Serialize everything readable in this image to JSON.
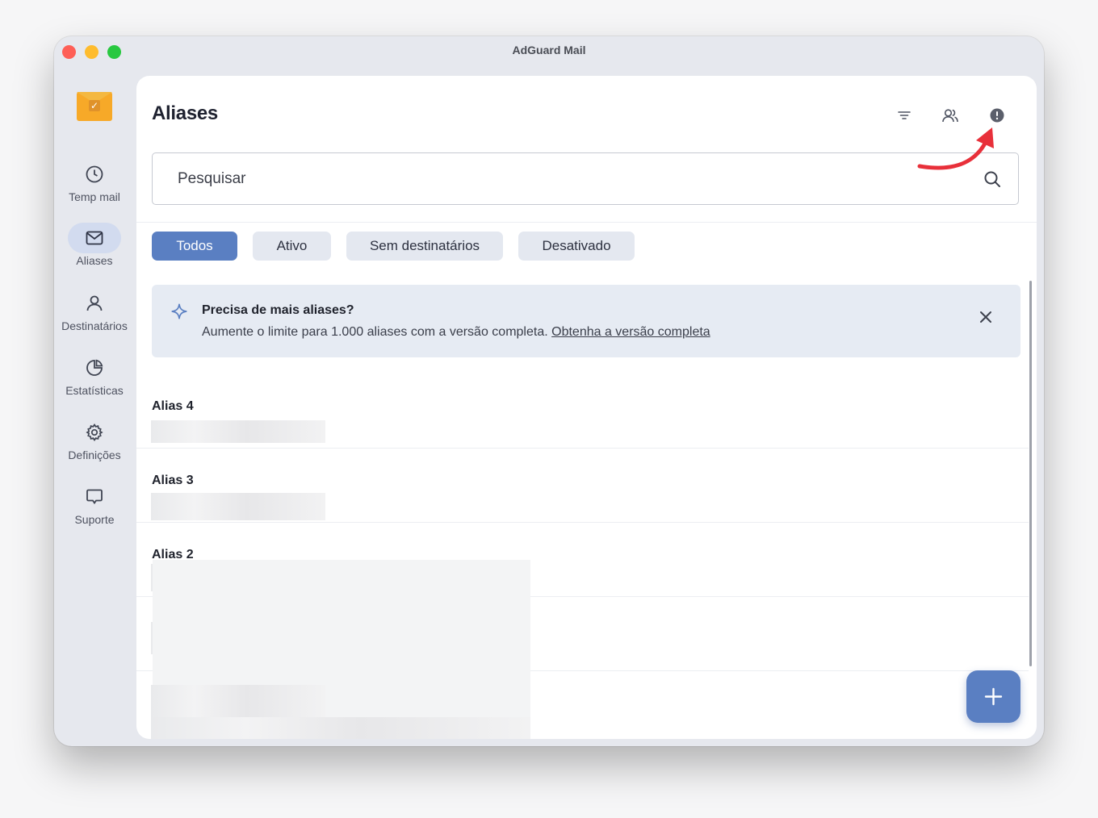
{
  "window": {
    "title": "AdGuard Mail"
  },
  "sidebar": {
    "items": [
      {
        "label": "Temp mail",
        "icon": "clock-icon",
        "active": false
      },
      {
        "label": "Aliases",
        "icon": "mail-icon",
        "active": true
      },
      {
        "label": "Destinatários",
        "icon": "user-icon",
        "active": false
      },
      {
        "label": "Estatísticas",
        "icon": "pie-chart-icon",
        "active": false
      },
      {
        "label": "Definições",
        "icon": "gear-icon",
        "active": false
      },
      {
        "label": "Suporte",
        "icon": "chat-bubble-icon",
        "active": false
      }
    ]
  },
  "header": {
    "title": "Aliases",
    "icons": [
      "filter-icon",
      "users-icon",
      "info-icon"
    ]
  },
  "search": {
    "placeholder": "Pesquisar"
  },
  "filters": [
    {
      "label": "Todos",
      "active": true
    },
    {
      "label": "Ativo",
      "active": false
    },
    {
      "label": "Sem destinatários",
      "active": false
    },
    {
      "label": "Desativado",
      "active": false
    }
  ],
  "promo": {
    "title": "Precisa de mais aliases?",
    "text": "Aumente o limite para 1.000 aliases com a versão completa.",
    "link": "Obtenha a versão completa"
  },
  "aliases": [
    {
      "name": "Alias 4"
    },
    {
      "name": "Alias 3"
    },
    {
      "name": "Alias 2"
    }
  ],
  "colors": {
    "accent": "#5a7fc2",
    "annotation": "#e8303a",
    "app_logo": "#f7a928"
  }
}
